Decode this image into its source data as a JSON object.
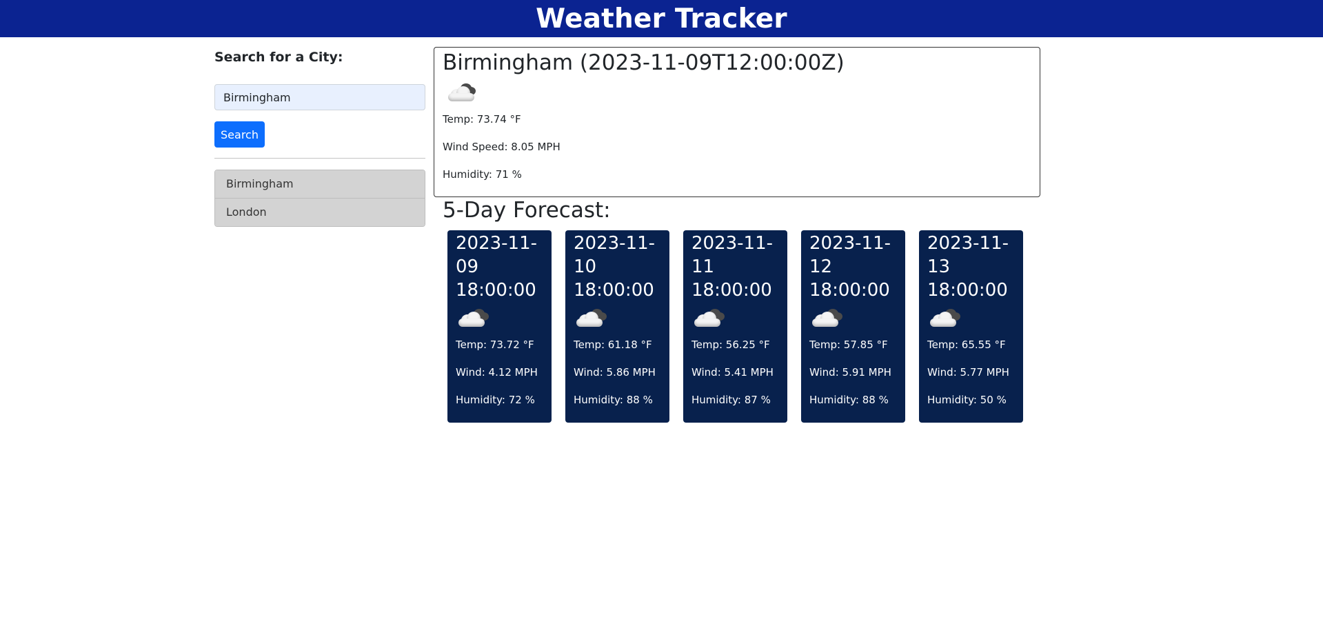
{
  "header": {
    "title": "Weather Tracker"
  },
  "search": {
    "label": "Search for a City:",
    "value": "Birmingham",
    "button_label": "Search"
  },
  "history": [
    {
      "label": "Birmingham"
    },
    {
      "label": "London"
    }
  ],
  "current": {
    "title": "Birmingham (2023-11-09T12:00:00Z)",
    "icon": "cloud-icon",
    "temp": "Temp: 73.74 °F",
    "wind": "Wind Speed: 8.05 MPH",
    "humidity": "Humidity: 71 %"
  },
  "forecast": {
    "title": "5-Day Forecast:",
    "days": [
      {
        "date": "2023-11-09 18:00:00",
        "icon": "cloud-icon",
        "temp": "Temp: 73.72 °F",
        "wind": "Wind: 4.12 MPH",
        "humidity": "Humidity: 72 %"
      },
      {
        "date": "2023-11-10 18:00:00",
        "icon": "cloud-icon",
        "temp": "Temp: 61.18 °F",
        "wind": "Wind: 5.86 MPH",
        "humidity": "Humidity: 88 %"
      },
      {
        "date": "2023-11-11 18:00:00",
        "icon": "cloud-icon",
        "temp": "Temp: 56.25 °F",
        "wind": "Wind: 5.41 MPH",
        "humidity": "Humidity: 87 %"
      },
      {
        "date": "2023-11-12 18:00:00",
        "icon": "cloud-icon",
        "temp": "Temp: 57.85 °F",
        "wind": "Wind: 5.91 MPH",
        "humidity": "Humidity: 88 %"
      },
      {
        "date": "2023-11-13 18:00:00",
        "icon": "cloud-icon",
        "temp": "Temp: 65.55 °F",
        "wind": "Wind: 5.77 MPH",
        "humidity": "Humidity: 50 %"
      }
    ]
  },
  "colors": {
    "header_bg": "#0b2391",
    "card_bg": "#08214d",
    "button_bg": "#0d6efd",
    "history_bg": "#d3d3d3",
    "input_bg": "#e8f0fe"
  }
}
